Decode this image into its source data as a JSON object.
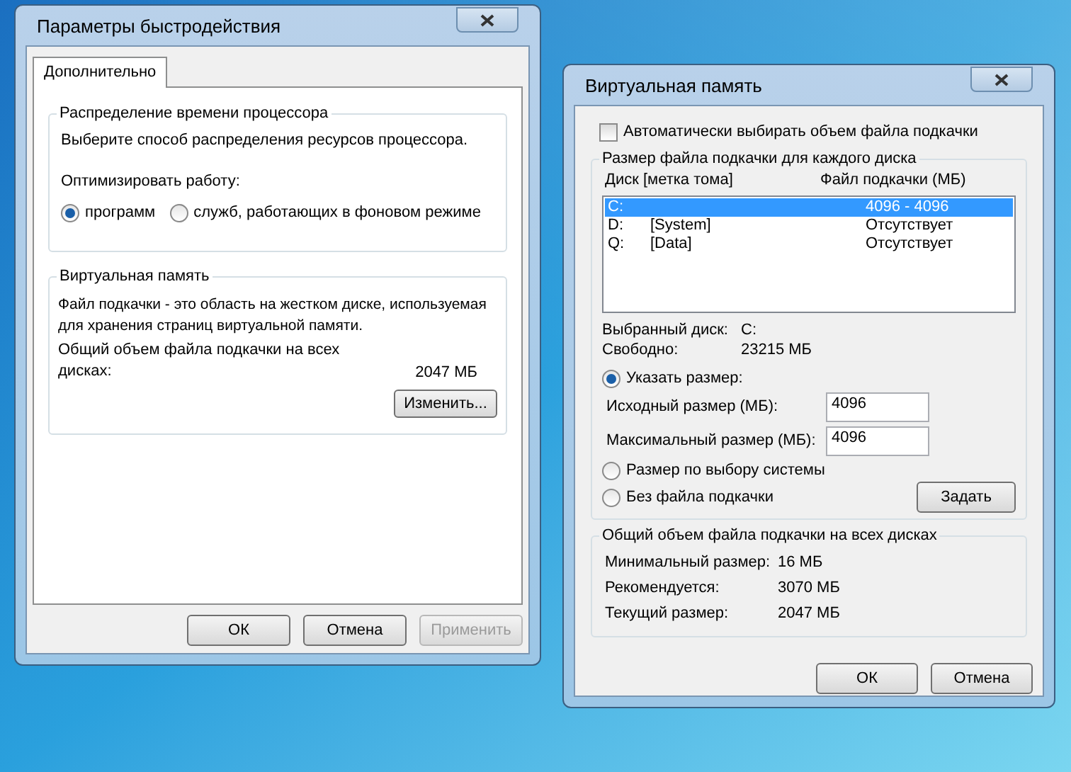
{
  "performance_window": {
    "title": "Параметры быстродействия",
    "tabs": [
      {
        "label": "Дополнительно",
        "selected": true
      }
    ],
    "cpu_group": {
      "title": "Распределение времени процессора",
      "description": "Выберите способ распределения ресурсов процессора.",
      "optimize_label": "Оптимизировать работу:",
      "options": [
        {
          "label": "программ",
          "selected": true
        },
        {
          "label": "служб, работающих в фоновом режиме",
          "selected": false
        }
      ]
    },
    "memory_group": {
      "title": "Виртуальная память",
      "description": "Файл подкачки - это область на жестком диске, используемая для хранения страниц виртуальной памяти.",
      "total_label": "Общий объем файла подкачки на всех дисках:",
      "total_value": "2047 МБ",
      "change_button": "Изменить..."
    },
    "buttons": [
      {
        "label": "ОК",
        "disabled": false
      },
      {
        "label": "Отмена",
        "disabled": false
      },
      {
        "label": "Применить",
        "disabled": true
      }
    ]
  },
  "virtual_memory_window": {
    "title": "Виртуальная память",
    "auto_checkbox": {
      "label": "Автоматически выбирать объем файла подкачки",
      "checked": false
    },
    "drives_group": {
      "title": "Размер файла подкачки для каждого диска",
      "columns": [
        "Диск [метка тома]",
        "Файл подкачки (МБ)"
      ],
      "drives": [
        {
          "letter": "C:",
          "paging_file": "4096 - 4096",
          "selected": true
        },
        {
          "letter": "D:",
          "volume_label": "[System]",
          "paging_file": "Отсутствует",
          "selected": false
        },
        {
          "letter": "Q:",
          "volume_label": "[Data]",
          "paging_file": "Отсутствует",
          "selected": false
        }
      ],
      "selected_drive_label": "Выбранный диск:",
      "selected_drive_value": "C:",
      "free_label": "Свободно:",
      "free_value": "23215 МБ",
      "options": [
        {
          "kind": "custom",
          "label": "Указать размер:",
          "selected": true
        },
        {
          "kind": "system",
          "label": "Размер по выбору системы",
          "selected": false
        },
        {
          "kind": "none",
          "label": "Без файла подкачки",
          "selected": false
        }
      ],
      "initial_size_label": "Исходный размер (МБ):",
      "initial_size_value": "4096",
      "max_size_label": "Максимальный размер (МБ):",
      "max_size_value": "4096",
      "set_button": "Задать"
    },
    "total_group": {
      "title": "Общий объем файла подкачки на всех дисках",
      "rows": [
        {
          "label": "Минимальный размер:",
          "value": "16 МБ"
        },
        {
          "label": "Рекомендуется:",
          "value": "3070 МБ"
        },
        {
          "label": "Текущий размер:",
          "value": "2047 МБ"
        }
      ]
    },
    "buttons": [
      {
        "label": "ОК",
        "disabled": false
      },
      {
        "label": "Отмена",
        "disabled": false
      }
    ]
  }
}
